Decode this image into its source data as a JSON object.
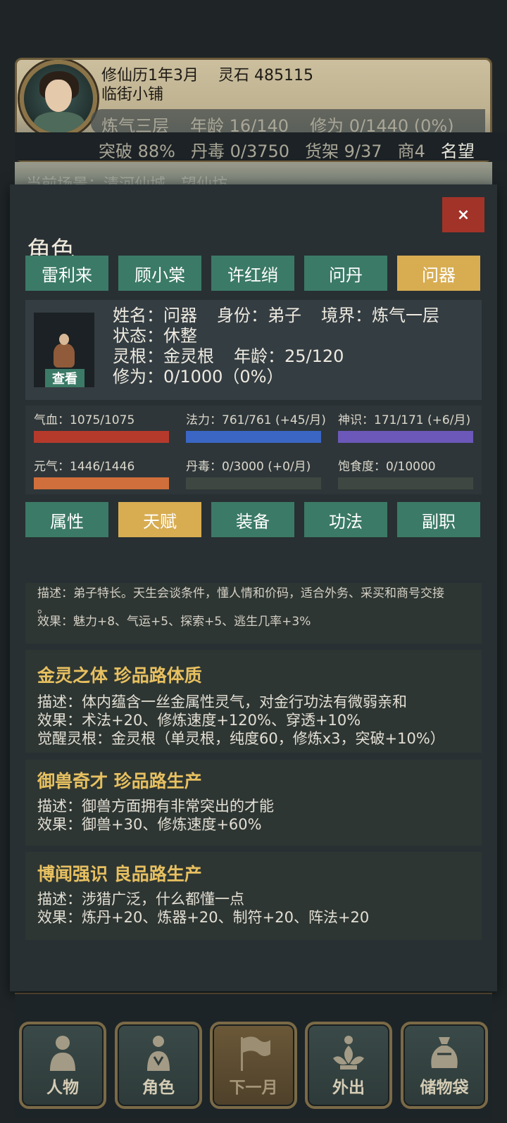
{
  "header": {
    "date": "修仙历1年3月",
    "spirit_stone": "灵石 485115",
    "location": "临街小铺",
    "realm": "炼气三层",
    "age": "年龄 16/140",
    "cultivation": "修为 0/1440 (0%)",
    "breakthrough": "突破 88%",
    "pill_poison": "丹毒 0/3750",
    "shelf": "货架 9/37",
    "merchant": "商4",
    "fame": "名望",
    "scene_tip": "当前场景：清河仙城　望仙坊"
  },
  "modal": {
    "close_label": "×",
    "title": "角色",
    "characters": [
      "雷利来",
      "顾小棠",
      "许红绡",
      "问丹",
      "问器"
    ],
    "active_character": 4,
    "info": {
      "name": "姓名：问器",
      "identity": "身份：弟子",
      "realm": "境界：炼气一层",
      "status": "状态：休整",
      "root": "灵根：金灵根",
      "age": "年龄：25/120",
      "cultivation": "修为：0/1000（0%）",
      "view_label": "查看"
    },
    "stats": [
      {
        "label": "气血：1075/1075",
        "fill": 1.0,
        "color": "#b53a2c"
      },
      {
        "label": "法力：761/761 (+45/月)",
        "fill": 1.0,
        "color": "#3b66c4"
      },
      {
        "label": "神识：171/171 (+6/月)",
        "fill": 1.0,
        "color": "#6b58b8"
      },
      {
        "label": "元气：1446/1446",
        "fill": 1.0,
        "color": "#d06f3c"
      },
      {
        "label": "丹毒：0/3000 (+0/月)",
        "fill": 0.0,
        "color": "#3f4742"
      },
      {
        "label": "饱食度：0/10000",
        "fill": 0.0,
        "color": "#3f4742"
      }
    ],
    "tabs": [
      "属性",
      "天赋",
      "装备",
      "功法",
      "副职"
    ],
    "active_tab": 1,
    "talents": {
      "partial": {
        "desc": "描述：弟子特长。天生会谈条件，懂人情和价码，适合外务、采买和商号交接",
        "desc_tail": "。",
        "effect": "效果：魅力+8、气运+5、探索+5、逃生几率+3%"
      },
      "items": [
        {
          "title": "金灵之体 珍品路体质",
          "desc": "描述：体内蕴含一丝金属性灵气，对金行功法有微弱亲和",
          "effect": "效果：术法+20、修炼速度+120%、穿透+10%",
          "extra": "觉醒灵根：金灵根（单灵根，纯度60，修炼x3，突破+10%）"
        },
        {
          "title": "御兽奇才 珍品路生产",
          "desc": "描述：御兽方面拥有非常突出的才能",
          "effect": "效果：御兽+30、修炼速度+60%"
        },
        {
          "title": "博闻强识 良品路生产",
          "desc": "描述：涉猎广泛，什么都懂一点",
          "effect": "效果：炼丹+20、炼器+20、制符+20、阵法+20"
        }
      ]
    }
  },
  "nav": [
    {
      "label": "人物",
      "icon": "person-icon"
    },
    {
      "label": "角色",
      "icon": "character-icon"
    },
    {
      "label": "下一月",
      "icon": "flag-icon"
    },
    {
      "label": "外出",
      "icon": "lotus-icon"
    },
    {
      "label": "储物袋",
      "icon": "bag-icon"
    }
  ]
}
